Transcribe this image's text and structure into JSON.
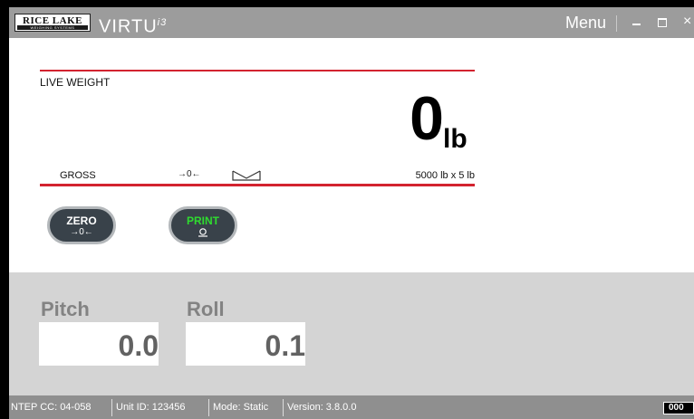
{
  "titlebar": {
    "logo_text": "RICE LAKE",
    "logo_subtext": "WEIGHING SYSTEMS",
    "product": "VIRTU",
    "product_mark": "i3",
    "menu_label": "Menu",
    "close_glyph": "×"
  },
  "scale": {
    "label": "LIVE WEIGHT",
    "weight": "0",
    "unit": "lb",
    "mode": "GROSS",
    "capacity": "5000 lb x 5 lb",
    "center_of_zero_icon": "→0←",
    "motion_icon": "motion-icon"
  },
  "buttons": {
    "zero_label": "ZERO",
    "zero_sub": "→0←",
    "print_label": "PRINT"
  },
  "sensors": {
    "pitch_label": "Pitch",
    "pitch_value": "0.0",
    "roll_label": "Roll",
    "roll_value": "0.1"
  },
  "status": {
    "ntep": "NTEP CC: 04-058",
    "unit_id": "Unit ID: 123456",
    "mode": "Mode: Static",
    "version": "Version: 3.8.0.0",
    "counter": "000"
  },
  "colors": {
    "accent_red": "#d3232f",
    "print_green": "#2fdc2f",
    "titlebar_gray": "#9c9c9c"
  }
}
